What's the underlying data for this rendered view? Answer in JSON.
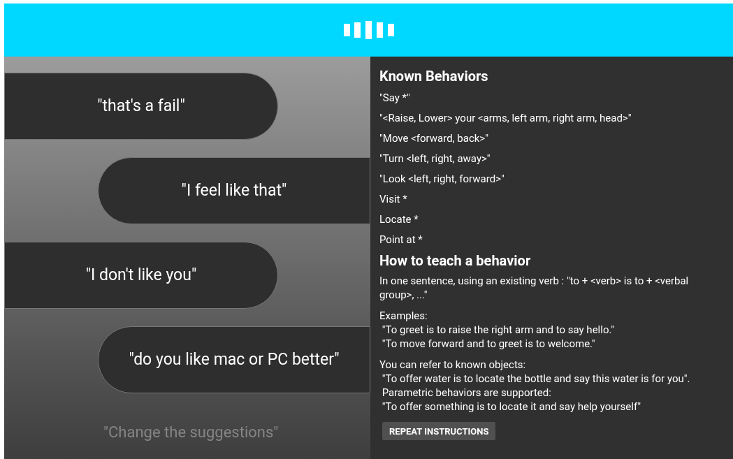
{
  "suggestions": [
    {
      "text": "\"that's a fail\"",
      "kind": "left"
    },
    {
      "text": "\"I feel like that\"",
      "kind": "right"
    },
    {
      "text": "\"I don't like you\"",
      "kind": "left"
    },
    {
      "text": "\"do you like mac or PC better\"",
      "kind": "right"
    }
  ],
  "change_suggestions": "\"Change the suggestions\"",
  "known_behaviors": {
    "title": "Known Behaviors",
    "items": [
      "\"Say *\"",
      "\"<Raise, Lower> your <arms, left arm, right arm, head>\"",
      "\"Move <forward, back>\"",
      "\"Turn <left, right, away>\"",
      "\"Look <left, right, forward>\"",
      "Visit *",
      "Locate *",
      "Point at *"
    ]
  },
  "how_to_teach": {
    "title": "How to teach a behavior",
    "paragraphs": [
      [
        "In one sentence, using an existing verb : \"to + <verb> is to + <verbal group>, ...\""
      ],
      [
        "Examples:",
        " \"To greet is to raise the right arm and to say hello.\"",
        " \"To move forward and to greet is to welcome.\""
      ],
      [
        "You can refer to known objects:",
        " \"To offer water is to locate the bottle and say this water is for you\".",
        " Parametric behaviors are supported:",
        " \"To offer something is to locate it and say help yourself\""
      ]
    ]
  },
  "repeat_button": "REPEAT INSTRUCTIONS"
}
